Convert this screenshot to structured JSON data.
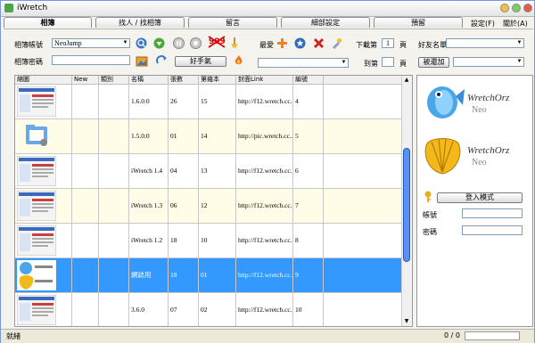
{
  "window": {
    "title": "iWretch"
  },
  "tabs": [
    {
      "label": "相簿"
    },
    {
      "label": "找人 / 找相簿"
    },
    {
      "label": "留言"
    },
    {
      "label": "細部設定"
    },
    {
      "label": "預留"
    }
  ],
  "menu": {
    "settings": "設定(F)",
    "about": "關於(A)"
  },
  "account": {
    "username_label": "相簿帳號",
    "username_value": "NeoJump",
    "password_label": "相簿密碼",
    "password_value": ""
  },
  "toolbar": {
    "badge_text": "999",
    "good_hands_label": "好手氣",
    "favorites_label": "最愛"
  },
  "download": {
    "from_label": "下載第",
    "from_value": "1",
    "from_suffix": "頁",
    "to_label": "到第",
    "to_value": "",
    "to_suffix": "頁"
  },
  "friends": {
    "list_label": "好友名單",
    "added_label": "被還加"
  },
  "grid": {
    "headers": [
      "縮圖",
      "New",
      "類別",
      "名稱",
      "張數",
      "第幾本",
      "封面Link",
      "編號"
    ],
    "rows": [
      {
        "thumb": "screenshot-thumb",
        "new": "",
        "category": "",
        "name": "1.6.0.0",
        "count": "26",
        "nth": "15",
        "link": "http://f12.wretch.cc...",
        "id": "4",
        "style": "white"
      },
      {
        "thumb": "folder-thumb",
        "new": "",
        "category": "",
        "name": "1.5.0.0",
        "count": "01",
        "nth": "14",
        "link": "http://pic.wretch.cc...",
        "id": "5",
        "style": "cream"
      },
      {
        "thumb": "screenshot-thumb",
        "new": "",
        "category": "",
        "name": "iWretch 1.4",
        "count": "04",
        "nth": "13",
        "link": "http://f12.wretch.cc...",
        "id": "6",
        "style": "white"
      },
      {
        "thumb": "screenshot-thumb",
        "new": "",
        "category": "",
        "name": "iWretch 1.3",
        "count": "06",
        "nth": "12",
        "link": "http://f12.wretch.cc...",
        "id": "7",
        "style": "cream"
      },
      {
        "thumb": "screenshot-thumb",
        "new": "",
        "category": "",
        "name": "iWretch 1.2",
        "count": "18",
        "nth": "10",
        "link": "http://f12.wretch.cc...",
        "id": "8",
        "style": "white"
      },
      {
        "thumb": "logo-thumb",
        "new": "",
        "category": "",
        "name": "網誌用",
        "count": "18",
        "nth": "01",
        "link": "http://f12.wretch.cc...",
        "id": "9",
        "style": "selected"
      },
      {
        "thumb": "screenshot-thumb",
        "new": "",
        "category": "",
        "name": "3.6.0",
        "count": "07",
        "nth": "02",
        "link": "http://f12.wretch.cc...",
        "id": "10",
        "style": "white"
      }
    ]
  },
  "side": {
    "logo1_title": "WretchOrz",
    "logo1_sub": "Neo",
    "logo2_title": "WretchOrz",
    "logo2_sub": "Neo",
    "login_button": "登入模式",
    "account_label": "帳號",
    "password_label": "密碼"
  },
  "status": {
    "left": "就緒",
    "progress_text": "0 / 0"
  },
  "colors": {
    "selected_row": "#3399ff",
    "cream_row": "#fffde7",
    "window_border": "#7a96df"
  }
}
